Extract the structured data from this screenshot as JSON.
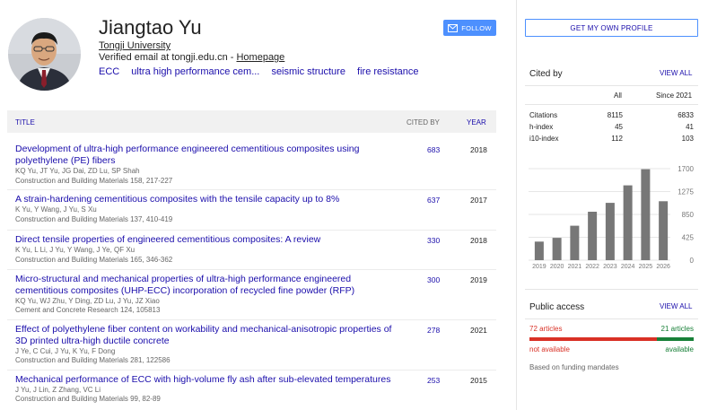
{
  "profile": {
    "name": "Jiangtao Yu",
    "affiliation": "Tongji University",
    "email_text": "Verified email at tongji.edu.cn - ",
    "homepage_label": "Homepage",
    "interests": [
      "ECC",
      "ultra high performance cem...",
      "seismic structure",
      "fire resistance"
    ],
    "follow_label": "FOLLOW",
    "get_profile_label": "GET MY OWN PROFILE"
  },
  "table": {
    "col_title": "TITLE",
    "col_cited": "CITED BY",
    "col_year": "YEAR",
    "rows": [
      {
        "title": "Development of ultra-high performance engineered cementitious composites using polyethylene (PE) fibers",
        "authors": "KQ Yu, JT Yu, JG Dai, ZD Lu, SP Shah",
        "venue": "Construction and Building Materials 158, 217-227",
        "cited": "683",
        "year": "2018"
      },
      {
        "title": "A strain-hardening cementitious composites with the tensile capacity up to 8%",
        "authors": "K Yu, Y Wang, J Yu, S Xu",
        "venue": "Construction and Building Materials 137, 410-419",
        "cited": "637",
        "year": "2017"
      },
      {
        "title": "Direct tensile properties of engineered cementitious composites: A review",
        "authors": "K Yu, L Li, J Yu, Y Wang, J Ye, QF Xu",
        "venue": "Construction and Building Materials 165, 346-362",
        "cited": "330",
        "year": "2018"
      },
      {
        "title": "Micro-structural and mechanical properties of ultra-high performance engineered cementitious composites (UHP-ECC) incorporation of recycled fine powder (RFP)",
        "authors": "KQ Yu, WJ Zhu, Y Ding, ZD Lu, J Yu, JZ Xiao",
        "venue": "Cement and Concrete Research 124, 105813",
        "cited": "300",
        "year": "2019"
      },
      {
        "title": "Effect of polyethylene fiber content on workability and mechanical-anisotropic properties of 3D printed ultra-high ductile concrete",
        "authors": "J Ye, C Cui, J Yu, K Yu, F Dong",
        "venue": "Construction and Building Materials 281, 122586",
        "cited": "278",
        "year": "2021"
      },
      {
        "title": "Mechanical performance of ECC with high-volume fly ash after sub-elevated temperatures",
        "authors": "J Yu, J Lin, Z Zhang, VC Li",
        "venue": "Construction and Building Materials 99, 82-89",
        "cited": "253",
        "year": "2015"
      }
    ]
  },
  "cited_by": {
    "title": "Cited by",
    "view_all": "VIEW ALL",
    "col_all": "All",
    "col_since": "Since 2021",
    "metrics": [
      {
        "label": "Citations",
        "all": "8115",
        "since": "6833"
      },
      {
        "label": "h-index",
        "all": "45",
        "since": "41"
      },
      {
        "label": "i10-index",
        "all": "112",
        "since": "103"
      }
    ]
  },
  "chart_data": {
    "type": "bar",
    "categories": [
      "2019",
      "2020",
      "2021",
      "2022",
      "2023",
      "2024",
      "2025",
      "2026"
    ],
    "values": [
      345,
      415,
      640,
      900,
      1065,
      1390,
      1690,
      1095
    ],
    "ylim": [
      0,
      1700
    ],
    "yticks": [
      "1700",
      "1275",
      "850",
      "425",
      "0"
    ],
    "bar_color": "#777777"
  },
  "public_access": {
    "title": "Public access",
    "view_all": "VIEW ALL",
    "not_available_count": "72 articles",
    "available_count": "21 articles",
    "not_available_label": "not available",
    "available_label": "available",
    "not_available_fraction": 0.774,
    "footer": "Based on funding mandates",
    "red": "#d93025",
    "green": "#188038"
  }
}
